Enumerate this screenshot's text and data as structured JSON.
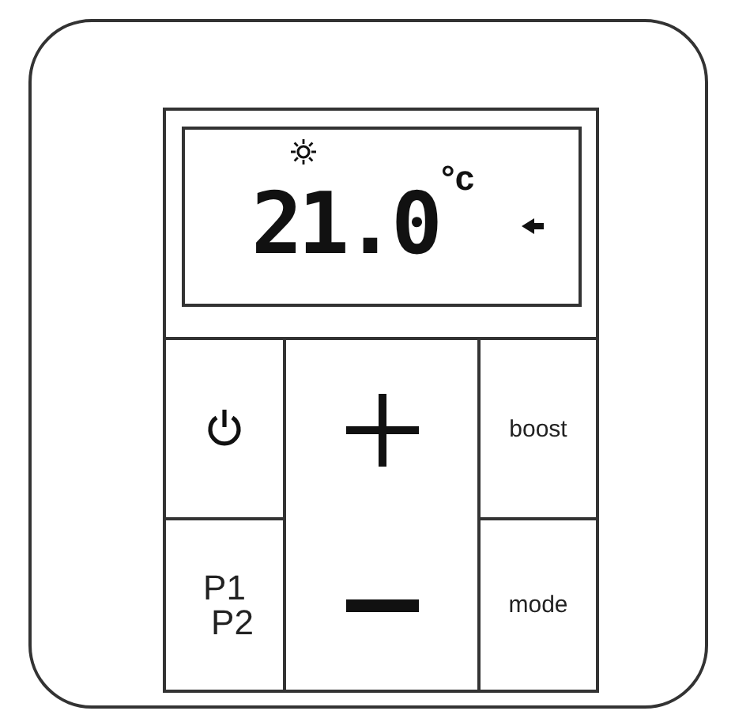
{
  "display": {
    "temperature": "21.0",
    "unit": "°c"
  },
  "keys": [
    {
      "kind": "power"
    },
    {
      "kind": "plus"
    },
    {
      "kind": "text",
      "label": "boost"
    },
    {
      "kind": "program",
      "labels": [
        "P1",
        "P2"
      ]
    },
    {
      "kind": "minus"
    },
    {
      "kind": "text",
      "label": "mode"
    }
  ]
}
